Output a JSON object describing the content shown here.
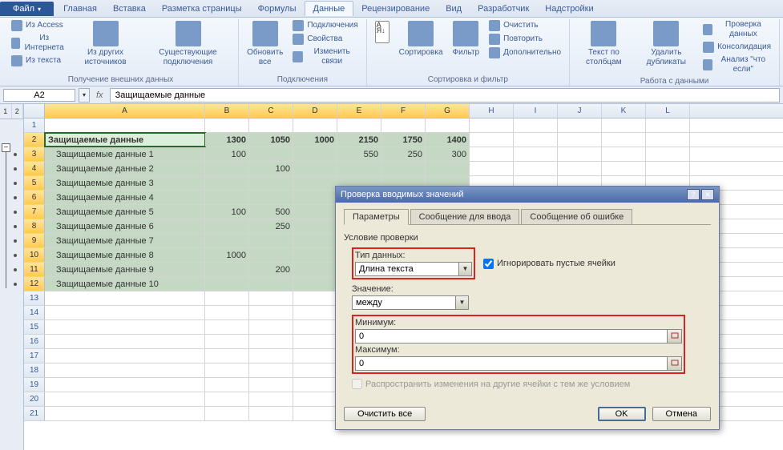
{
  "ribbon": {
    "tabs": {
      "file": "Файл",
      "home": "Главная",
      "insert": "Вставка",
      "pagelayout": "Разметка страницы",
      "formulas": "Формулы",
      "data": "Данные",
      "review": "Рецензирование",
      "view": "Вид",
      "developer": "Разработчик",
      "addins": "Надстройки"
    },
    "groups": {
      "external": {
        "access": "Из Access",
        "web": "Из Интернета",
        "text": "Из текста",
        "other": "Из других источников",
        "existing": "Существующие подключения",
        "label": "Получение внешних данных"
      },
      "connections": {
        "refresh": "Обновить все",
        "conn": "Подключения",
        "props": "Свойства",
        "editlinks": "Изменить связи",
        "label": "Подключения"
      },
      "sort": {
        "sort": "Сортировка",
        "filter": "Фильтр",
        "clear": "Очистить",
        "reapply": "Повторить",
        "advanced": "Дополнительно",
        "label": "Сортировка и фильтр"
      },
      "tools": {
        "textcols": "Текст по столбцам",
        "removedup": "Удалить дубликаты",
        "validation": "Проверка данных",
        "consolidate": "Консолидация",
        "whatif": "Анализ \"что если\"",
        "label": "Работа с данными"
      }
    }
  },
  "formula_bar": {
    "name_box": "A2",
    "fx": "fx",
    "formula": "Защищаемые данные"
  },
  "outline_levels": [
    "1",
    "2"
  ],
  "columns": [
    "A",
    "B",
    "C",
    "D",
    "E",
    "F",
    "G",
    "H",
    "I",
    "J",
    "K",
    "L"
  ],
  "selected_cols": [
    "A",
    "B",
    "C",
    "D",
    "E",
    "F",
    "G"
  ],
  "rows": [
    {
      "n": 1,
      "sel": false,
      "cells": [
        "",
        "",
        "",
        "",
        "",
        "",
        ""
      ]
    },
    {
      "n": 2,
      "sel": true,
      "bold": true,
      "active": true,
      "cells": [
        "Защищаемые данные",
        "1300",
        "1050",
        "1000",
        "2150",
        "1750",
        "1400"
      ]
    },
    {
      "n": 3,
      "sel": true,
      "cells": [
        "Защищаемые данные 1",
        "100",
        "",
        "",
        "550",
        "250",
        "300"
      ]
    },
    {
      "n": 4,
      "sel": true,
      "cells": [
        "Защищаемые данные 2",
        "",
        "100",
        "",
        "",
        "",
        ""
      ]
    },
    {
      "n": 5,
      "sel": true,
      "cells": [
        "Защищаемые данные 3",
        "",
        "",
        "",
        "",
        "",
        ""
      ]
    },
    {
      "n": 6,
      "sel": true,
      "cells": [
        "Защищаемые данные 4",
        "",
        "",
        "",
        "",
        "",
        ""
      ]
    },
    {
      "n": 7,
      "sel": true,
      "cells": [
        "Защищаемые данные 5",
        "100",
        "500",
        "",
        "",
        "",
        ""
      ]
    },
    {
      "n": 8,
      "sel": true,
      "cells": [
        "Защищаемые данные 6",
        "",
        "250",
        "",
        "",
        "",
        ""
      ]
    },
    {
      "n": 9,
      "sel": true,
      "cells": [
        "Защищаемые данные 7",
        "",
        "",
        "",
        "",
        "",
        ""
      ]
    },
    {
      "n": 10,
      "sel": true,
      "cells": [
        "Защищаемые данные 8",
        "1000",
        "",
        "",
        "",
        "",
        ""
      ]
    },
    {
      "n": 11,
      "sel": true,
      "cells": [
        "Защищаемые данные 9",
        "",
        "200",
        "",
        "",
        "",
        ""
      ]
    },
    {
      "n": 12,
      "sel": true,
      "cells": [
        "Защищаемые данные 10",
        "",
        "",
        "",
        "",
        "",
        ""
      ]
    },
    {
      "n": 13
    },
    {
      "n": 14
    },
    {
      "n": 15
    },
    {
      "n": 16
    },
    {
      "n": 17
    },
    {
      "n": 18
    },
    {
      "n": 19
    },
    {
      "n": 20
    },
    {
      "n": 21
    }
  ],
  "dialog": {
    "title": "Проверка вводимых значений",
    "tabs": {
      "settings": "Параметры",
      "input": "Сообщение для ввода",
      "error": "Сообщение об ошибке"
    },
    "condition_label": "Условие проверки",
    "type_label": "Тип данных:",
    "type_value": "Длина текста",
    "ignore_blank": "Игнорировать пустые ячейки",
    "data_label": "Значение:",
    "data_value": "между",
    "min_label": "Минимум:",
    "min_value": "0",
    "max_label": "Максимум:",
    "max_value": "0",
    "apply_label": "Распространить изменения на другие ячейки с тем же условием",
    "clear_btn": "Очистить все",
    "ok_btn": "OK",
    "cancel_btn": "Отмена"
  }
}
